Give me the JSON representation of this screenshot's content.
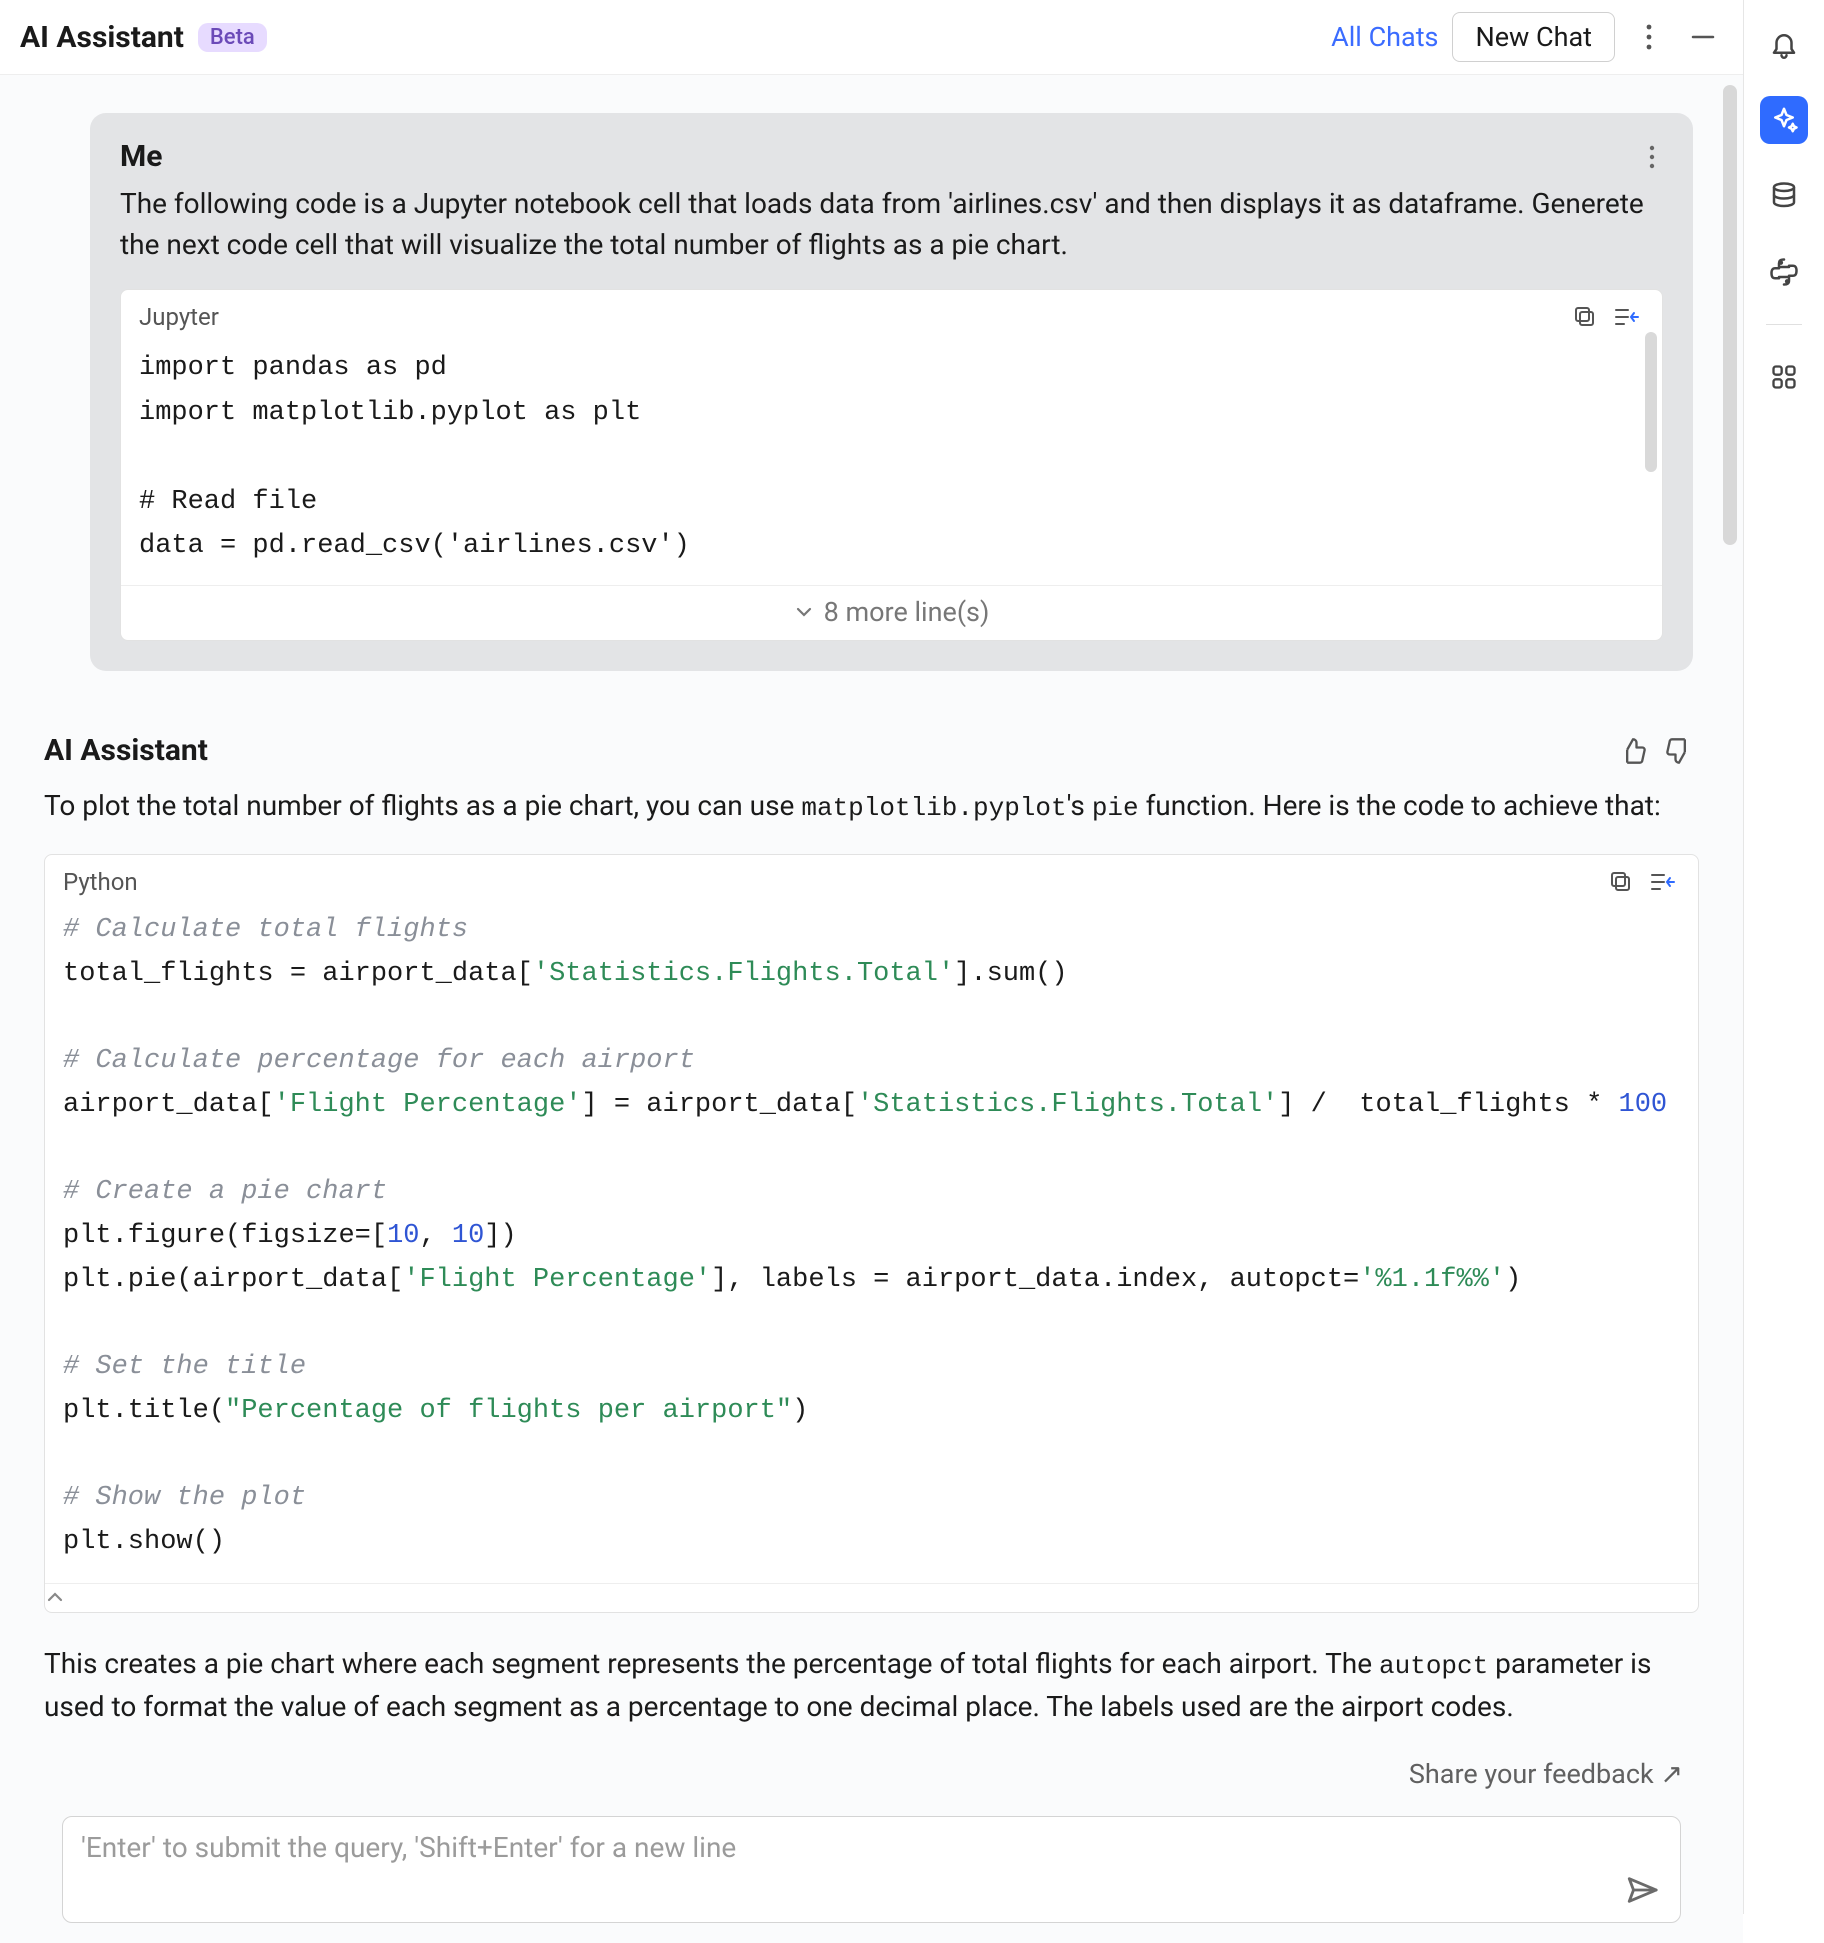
{
  "header": {
    "title": "AI Assistant",
    "beta": "Beta",
    "all_chats": "All Chats",
    "new_chat": "New Chat"
  },
  "me": {
    "label": "Me",
    "text": "The following code is a Jupyter notebook cell that loads data from 'airlines.csv' and then displays it as dataframe. Generete the next code cell that will visualize the total number of flights as a pie chart.",
    "code_lang": "Jupyter",
    "code": "import pandas as pd\nimport matplotlib.pyplot as plt\n\n# Read file\ndata = pd.read_csv('airlines.csv')",
    "more_lines": "8 more line(s)"
  },
  "assistant": {
    "label": "AI Assistant",
    "intro_pre": "To plot the total number of flights as a pie chart, you can use ",
    "intro_code1": "matplotlib.pyplot",
    "intro_mid": "'s ",
    "intro_code2": "pie",
    "intro_post": " function. Here is the code to achieve that:",
    "code_lang": "Python",
    "code": {
      "c1": "# Calculate total flights",
      "l1a": "total_flights = airport_data[",
      "l1s": "'Statistics.Flights.Total'",
      "l1b": "].sum()",
      "c2": "# Calculate percentage for each airport",
      "l2a": "airport_data[",
      "l2s1": "'Flight Percentage'",
      "l2b": "] = airport_data[",
      "l2s2": "'Statistics.Flights.Total'",
      "l2c": "] /  total_flights * ",
      "l2n": "100",
      "c3": "# Create a pie chart",
      "l3a": "plt.figure(figsize=[",
      "l3n1": "10",
      "l3m": ", ",
      "l3n2": "10",
      "l3b": "])",
      "l4a": "plt.pie(airport_data[",
      "l4s1": "'Flight Percentage'",
      "l4b": "], labels = airport_data.index, autopct=",
      "l4s2": "'%1.1f%%'",
      "l4c": ")",
      "c4": "# Set the title",
      "l5a": "plt.title(",
      "l5s": "\"Percentage of flights per airport\"",
      "l5b": ")",
      "c5": "# Show the plot",
      "l6": "plt.show()"
    },
    "after_pre": "This creates a pie chart where each segment represents the percentage of total flights for each airport. The ",
    "after_code": "autopct",
    "after_post": " parameter is used to format the value of each segment as a percentage to one decimal place. The labels used are the airport codes."
  },
  "feedback": "Share your feedback ↗",
  "input_placeholder": "'Enter' to submit the query, 'Shift+Enter' for a new line",
  "icons": {
    "bell": "bell-icon",
    "sparkle": "sparkle-icon",
    "db": "database-icon",
    "python": "python-icon",
    "grid": "grid-icon"
  }
}
